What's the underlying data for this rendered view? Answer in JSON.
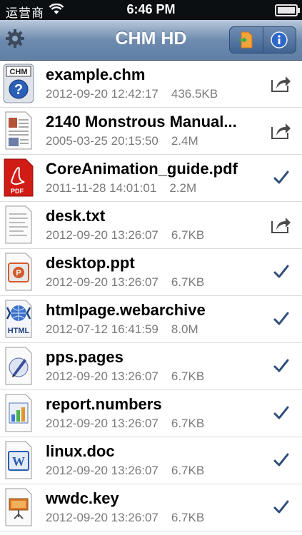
{
  "status": {
    "carrier": "运营商",
    "time": "6:46 PM"
  },
  "nav": {
    "title": "CHM HD",
    "settings_icon": "gear-icon",
    "import_icon": "import-file-icon",
    "info_icon": "info-icon"
  },
  "files": [
    {
      "name": "example.chm",
      "date": "2012-09-20 12:42:17",
      "size": "436.5KB",
      "icon": "chm-help-icon",
      "accessory": "share"
    },
    {
      "name": "2140 Monstrous Manual...",
      "date": "2005-03-25 20:15:50",
      "size": "2.4M",
      "icon": "document-image-icon",
      "accessory": "share"
    },
    {
      "name": "CoreAnimation_guide.pdf",
      "date": "2011-11-28 14:01:01",
      "size": "2.2M",
      "icon": "pdf-icon",
      "accessory": "check"
    },
    {
      "name": "desk.txt",
      "date": "2012-09-20 13:26:07",
      "size": "6.7KB",
      "icon": "text-file-icon",
      "accessory": "share"
    },
    {
      "name": "desktop.ppt",
      "date": "2012-09-20 13:26:07",
      "size": "6.7KB",
      "icon": "powerpoint-icon",
      "accessory": "check"
    },
    {
      "name": "htmlpage.webarchive",
      "date": "2012-07-12 16:41:59",
      "size": "8.0M",
      "icon": "html-icon",
      "accessory": "check",
      "badge": "HTML"
    },
    {
      "name": "pps.pages",
      "date": "2012-09-20 13:26:07",
      "size": "6.7KB",
      "icon": "pages-icon",
      "accessory": "check"
    },
    {
      "name": "report.numbers",
      "date": "2012-09-20 13:26:07",
      "size": "6.7KB",
      "icon": "numbers-icon",
      "accessory": "check"
    },
    {
      "name": "linux.doc",
      "date": "2012-09-20 13:26:07",
      "size": "6.7KB",
      "icon": "word-icon",
      "accessory": "check"
    },
    {
      "name": "wwdc.key",
      "date": "2012-09-20 13:26:07",
      "size": "6.7KB",
      "icon": "keynote-icon",
      "accessory": "check"
    }
  ],
  "chm_badge": "CHM",
  "pdf_badge": "PDF"
}
